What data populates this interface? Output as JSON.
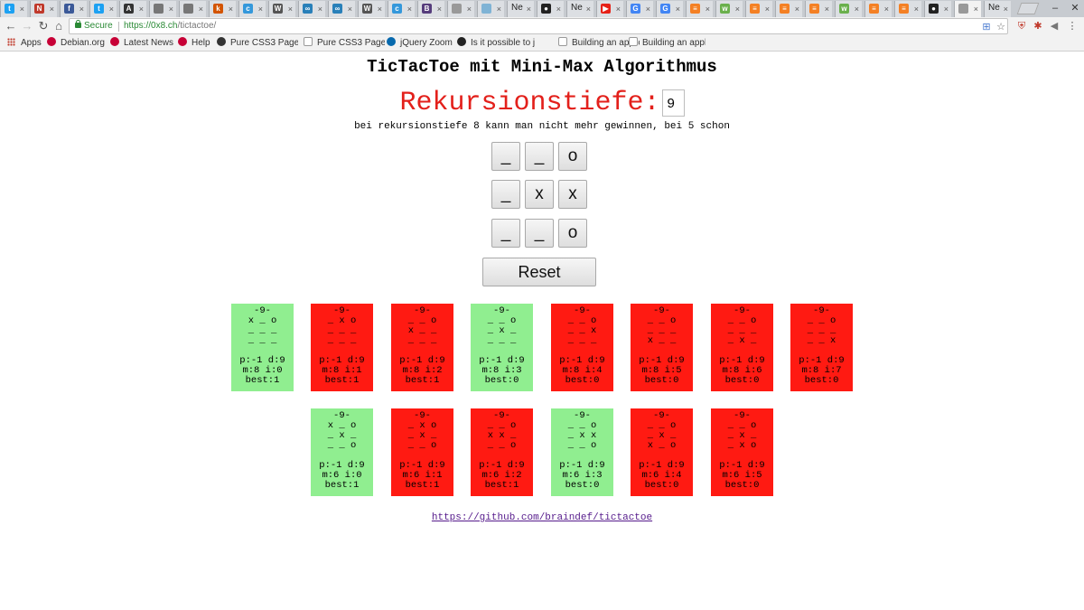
{
  "browser": {
    "tabs": [
      {
        "icon": "twitter-icon",
        "color": "#1da1f2",
        "glyph": "t"
      },
      {
        "icon": "news-icon",
        "color": "#c0392b",
        "glyph": "N"
      },
      {
        "icon": "facebook-icon",
        "color": "#3b5998",
        "glyph": "f"
      },
      {
        "icon": "twitter-icon",
        "color": "#1da1f2",
        "glyph": "t"
      },
      {
        "icon": "bookmark-icon",
        "color": "#333333",
        "glyph": "A"
      },
      {
        "icon": "apple-icon",
        "color": "#777777",
        "glyph": ""
      },
      {
        "icon": "apple-icon",
        "color": "#777777",
        "glyph": ""
      },
      {
        "icon": "key-icon",
        "color": "#d35400",
        "glyph": "k"
      },
      {
        "icon": "cloud-icon",
        "color": "#3498db",
        "glyph": "c"
      },
      {
        "icon": "wikipedia-icon",
        "color": "#555555",
        "glyph": "W"
      },
      {
        "icon": "link-icon",
        "color": "#2980b9",
        "glyph": "∞"
      },
      {
        "icon": "link-icon",
        "color": "#2980b9",
        "glyph": "∞"
      },
      {
        "icon": "wikipedia-icon",
        "color": "#555555",
        "glyph": "W"
      },
      {
        "icon": "cloud-icon",
        "color": "#3498db",
        "glyph": "c"
      },
      {
        "icon": "bootstrap-icon",
        "color": "#563d7c",
        "glyph": "B"
      },
      {
        "icon": "page-icon",
        "color": "#999999",
        "glyph": ""
      },
      {
        "icon": "chart-icon",
        "color": "#7fb3d5",
        "glyph": ""
      },
      {
        "label": "Ne"
      },
      {
        "icon": "github-icon",
        "color": "#222222",
        "glyph": "●"
      },
      {
        "label": "Ne"
      },
      {
        "icon": "youtube-icon",
        "color": "#e62117",
        "glyph": "▶"
      },
      {
        "icon": "google-icon",
        "color": "#4285f4",
        "glyph": "G"
      },
      {
        "icon": "google-icon",
        "color": "#4285f4",
        "glyph": "G"
      },
      {
        "icon": "stackoverflow-icon",
        "color": "#f48024",
        "glyph": "≡"
      },
      {
        "icon": "chat-icon",
        "color": "#6ab04c",
        "glyph": "w"
      },
      {
        "icon": "stackoverflow-icon",
        "color": "#f48024",
        "glyph": "≡"
      },
      {
        "icon": "stackoverflow-icon",
        "color": "#f48024",
        "glyph": "≡"
      },
      {
        "icon": "stackoverflow-icon",
        "color": "#f48024",
        "glyph": "≡"
      },
      {
        "icon": "chat-icon",
        "color": "#6ab04c",
        "glyph": "w"
      },
      {
        "icon": "stackoverflow-icon",
        "color": "#f48024",
        "glyph": "≡"
      },
      {
        "icon": "stackoverflow-icon",
        "color": "#f48024",
        "glyph": "≡"
      },
      {
        "icon": "github-icon",
        "color": "#222222",
        "glyph": "●"
      },
      {
        "icon": "page-icon",
        "color": "#999999",
        "glyph": "",
        "active": true
      },
      {
        "label": "Ne"
      }
    ],
    "url": {
      "secure_label": "Secure",
      "scheme_host": "https://0x8.ch",
      "path": "/tictactoe/"
    },
    "bookmarks": [
      {
        "label": "Apps",
        "icon": "apps-grid-icon"
      },
      {
        "label": "Debian.org",
        "icon": "debian-icon"
      },
      {
        "label": "Latest News",
        "icon": "debian-icon"
      },
      {
        "label": "Help",
        "icon": "debian-icon"
      },
      {
        "label": "Pure CSS3 Page",
        "icon": "css-icon"
      },
      {
        "label": "Pure CSS3 Page",
        "icon": "page-icon"
      },
      {
        "label": "jQuery Zoom",
        "icon": "jquery-icon"
      },
      {
        "label": "Is it possible to j",
        "icon": "github-icon"
      },
      {
        "label": "Building an applic",
        "icon": "page-icon"
      },
      {
        "label": "Building an applic",
        "icon": "page-icon"
      }
    ]
  },
  "page": {
    "title": "TicTacToe mit Mini-Max Algorithmus",
    "depth_label": "Rekursionstiefe:",
    "depth_value": "9",
    "hint": "bei rekursionstiefe 8 kann man nicht mehr gewinnen, bei 5 schon",
    "board": [
      [
        "_",
        "_",
        "o"
      ],
      [
        "_",
        "x",
        "x"
      ],
      [
        "_",
        "_",
        "o"
      ]
    ],
    "reset_label": "Reset",
    "cards_row1": [
      {
        "color": "green",
        "head": "-9-",
        "rows": [
          "x _ o",
          "_ _ _",
          "_ _ _"
        ],
        "stats": [
          "p:-1 d:9",
          "m:8 i:0",
          "best:1"
        ]
      },
      {
        "color": "red",
        "head": "-9-",
        "rows": [
          "_ x o",
          "_ _ _",
          "_ _ _"
        ],
        "stats": [
          "p:-1 d:9",
          "m:8 i:1",
          "best:1"
        ]
      },
      {
        "color": "red",
        "head": "-9-",
        "rows": [
          "_ _ o",
          "x _ _",
          "_ _ _"
        ],
        "stats": [
          "p:-1 d:9",
          "m:8 i:2",
          "best:1"
        ]
      },
      {
        "color": "green",
        "head": "-9-",
        "rows": [
          "_ _ o",
          "_ x _",
          "_ _ _"
        ],
        "stats": [
          "p:-1 d:9",
          "m:8 i:3",
          "best:0"
        ]
      },
      {
        "color": "red",
        "head": "-9-",
        "rows": [
          "_ _ o",
          "_ _ x",
          "_ _ _"
        ],
        "stats": [
          "p:-1 d:9",
          "m:8 i:4",
          "best:0"
        ]
      },
      {
        "color": "red",
        "head": "-9-",
        "rows": [
          "_ _ o",
          "_ _ _",
          "x _ _"
        ],
        "stats": [
          "p:-1 d:9",
          "m:8 i:5",
          "best:0"
        ]
      },
      {
        "color": "red",
        "head": "-9-",
        "rows": [
          "_ _ o",
          "_ _ _",
          "_ x _"
        ],
        "stats": [
          "p:-1 d:9",
          "m:8 i:6",
          "best:0"
        ]
      },
      {
        "color": "red",
        "head": "-9-",
        "rows": [
          "_ _ o",
          "_ _ _",
          "_ _ x"
        ],
        "stats": [
          "p:-1 d:9",
          "m:8 i:7",
          "best:0"
        ]
      }
    ],
    "cards_row2": [
      {
        "color": "green",
        "head": "-9-",
        "rows": [
          "x _ o",
          "_ x _",
          "_ _ o"
        ],
        "stats": [
          "p:-1 d:9",
          "m:6 i:0",
          "best:1"
        ]
      },
      {
        "color": "red",
        "head": "-9-",
        "rows": [
          "_ x o",
          "_ x _",
          "_ _ o"
        ],
        "stats": [
          "p:-1 d:9",
          "m:6 i:1",
          "best:1"
        ]
      },
      {
        "color": "red",
        "head": "-9-",
        "rows": [
          "_ _ o",
          "x x _",
          "_ _ o"
        ],
        "stats": [
          "p:-1 d:9",
          "m:6 i:2",
          "best:1"
        ]
      },
      {
        "color": "green",
        "head": "-9-",
        "rows": [
          "_ _ o",
          "_ x x",
          "_ _ o"
        ],
        "stats": [
          "p:-1 d:9",
          "m:6 i:3",
          "best:0"
        ]
      },
      {
        "color": "red",
        "head": "-9-",
        "rows": [
          "_ _ o",
          "_ x _",
          "x _ o"
        ],
        "stats": [
          "p:-1 d:9",
          "m:6 i:4",
          "best:0"
        ]
      },
      {
        "color": "red",
        "head": "-9-",
        "rows": [
          "_ _ o",
          "_ x _",
          "_ x o"
        ],
        "stats": [
          "p:-1 d:9",
          "m:6 i:5",
          "best:0"
        ]
      }
    ],
    "github_link": "https://github.com/braindef/tictactoe",
    "colors": {
      "green": "#90ee90",
      "red": "#ff1a12",
      "depth_red": "#e3201b",
      "link": "#551a8b"
    }
  }
}
